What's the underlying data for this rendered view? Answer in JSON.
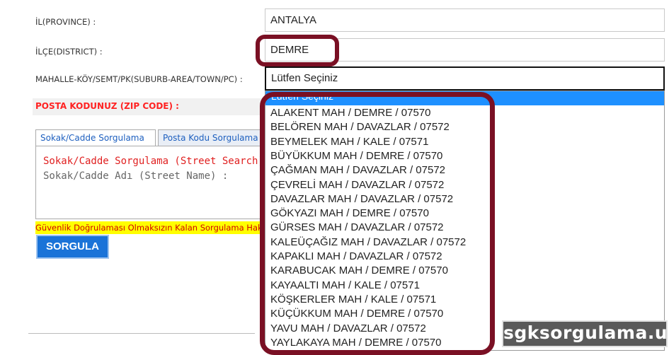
{
  "form": {
    "province_label": "İL(PROVINCE) :",
    "province_value": "ANTALYA",
    "district_label": "İLÇE(DISTRICT) :",
    "district_value": "DEMRE",
    "suburb_label": "MAHALLE-KÖY/SEMT/PK(SUBURB-AREA/TOWN/PC) :",
    "suburb_value": "Lütfen Seçiniz",
    "zip_label": "POSTA KODUNUZ (ZIP CODE) :"
  },
  "tabs": [
    {
      "label": "Sokak/Cadde Sorgulama"
    },
    {
      "label": "Posta Kodu Sorgulama"
    }
  ],
  "panel": {
    "title": "Sokak/Cadde Sorgulama (Street Search)",
    "street_label": "Sokak/Cadde Adı (Street Name) :"
  },
  "warning": "Güvenlik Doğrulaması Olmaksızın Kalan Sorgulama Hakkınız",
  "button_label": "SORGULA",
  "dropdown": {
    "highlighted": "Lütfen Seçiniz",
    "options": [
      "ALAKENT MAH / DEMRE / 07570",
      "BELÖREN MAH / DAVAZLAR / 07572",
      "BEYMELEK MAH / KALE / 07571",
      "BÜYÜKKUM MAH / DEMRE / 07570",
      "ÇAĞMAN MAH / DAVAZLAR / 07572",
      "ÇEVRELİ MAH / DAVAZLAR / 07572",
      "DAVAZLAR MAH / DAVAZLAR / 07572",
      "GÖKYAZI MAH / DEMRE / 07570",
      "GÜRSES MAH / DAVAZLAR / 07572",
      "KALEÜÇAĞIZ MAH / DAVAZLAR / 07572",
      "KAPAKLI MAH / DAVAZLAR / 07572",
      "KARABUCAK MAH / DEMRE / 07570",
      "KAYAALTI MAH / KALE / 07571",
      "KÖŞKERLER MAH / KALE / 07571",
      "KÜÇÜKKUM MAH / DEMRE / 07570",
      "YAVU MAH / DAVAZLAR / 07572",
      "YAYLAKAYA MAH / DEMRE / 07570"
    ]
  },
  "watermark": "sgksorgulama.us",
  "colors": {
    "highlight_border": "#7a1024",
    "selected_option": "#1e90ff",
    "button": "#1a73d8",
    "zip_label": "#ff2222",
    "warning_bg": "#ffff00"
  }
}
